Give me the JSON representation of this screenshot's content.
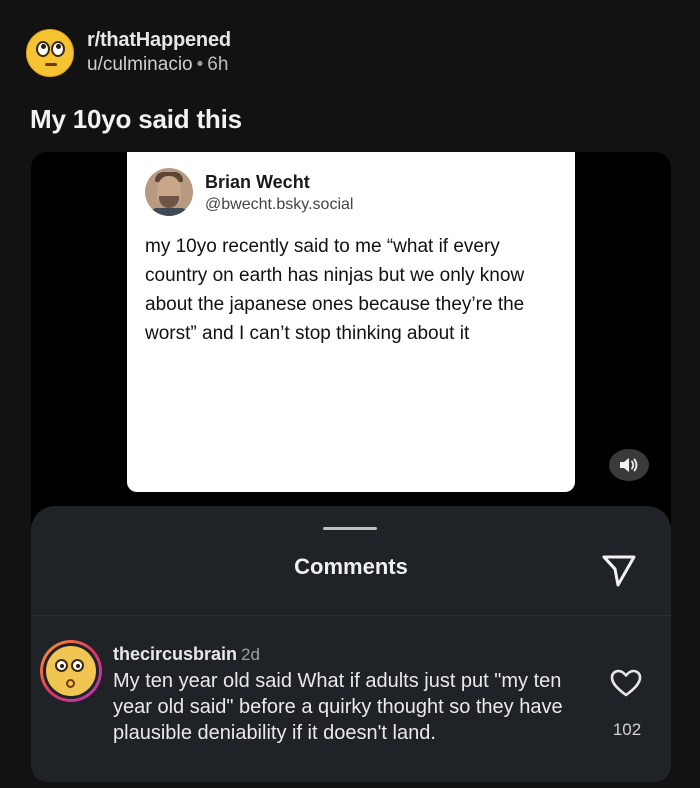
{
  "post": {
    "subreddit": "r/thatHappened",
    "author": "u/culminacio",
    "separator": "•",
    "age": "6h",
    "title": "My 10yo said this"
  },
  "tweet": {
    "name": "Brian Wecht",
    "handle": "@bwecht.bsky.social",
    "text": "my 10yo recently said to me “what if every country on earth has ninjas but we only know about the japanese ones because they’re the worst” and I can’t stop thinking about it"
  },
  "media": {
    "volume_icon": "volume-icon"
  },
  "comments_sheet": {
    "title": "Comments",
    "send_icon": "send-icon",
    "comments": [
      {
        "username": "thecircusbrain",
        "age": "2d",
        "text": "My ten year old said What if adults just put \"my ten year old said\" before a quirky thought so they have plausible deniability if it doesn't land.",
        "likes": "102",
        "like_icon": "heart-icon"
      }
    ]
  }
}
